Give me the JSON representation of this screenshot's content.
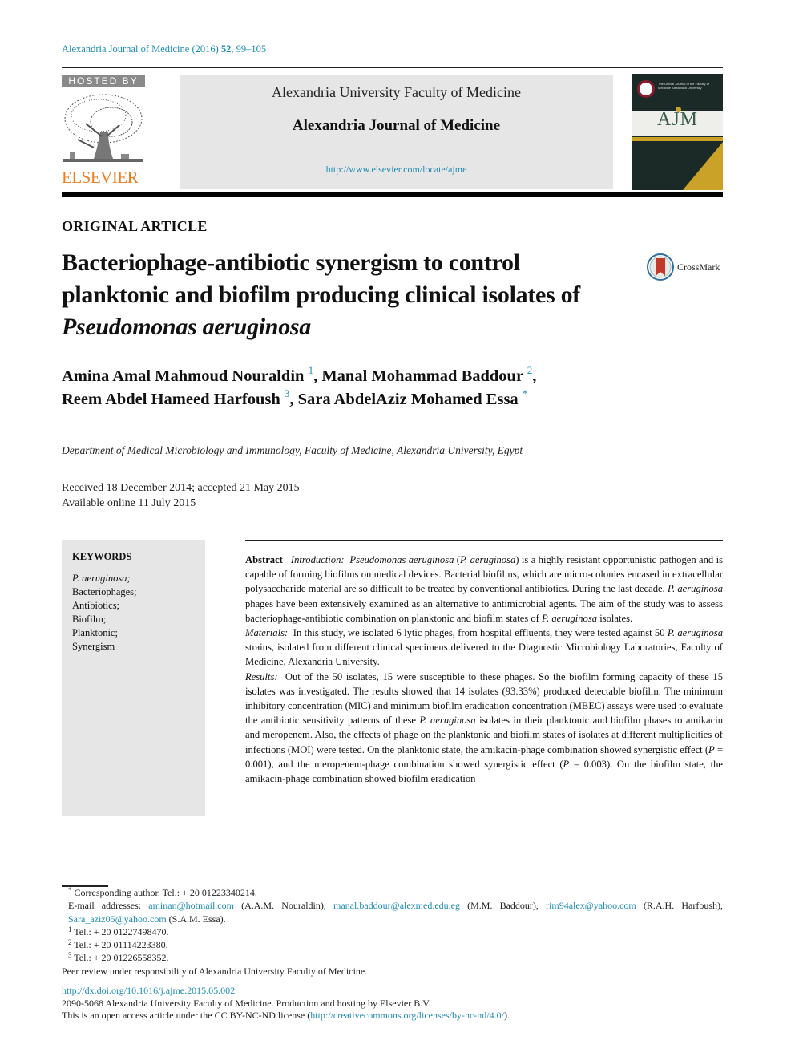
{
  "citation": {
    "journal": "Alexandria Journal of Medicine (2016)",
    "volume": "52",
    "pages": ", 99–105"
  },
  "header": {
    "hosted_by": "HOSTED BY",
    "publisher_logo": "ELSEVIER",
    "university": "Alexandria University Faculty of Medicine",
    "journal_name": "Alexandria Journal of Medicine",
    "journal_url": "http://www.elsevier.com/locate/ajme",
    "cover": {
      "abbrev": "AJM",
      "tagline": "The Official Journal of the Faculty of Medicine Alexandria University"
    }
  },
  "article": {
    "section": "ORIGINAL ARTICLE",
    "title_line1": "Bacteriophage-antibiotic synergism to control",
    "title_line2": "planktonic and biofilm producing clinical isolates of",
    "title_line3_italic": "Pseudomonas aeruginosa",
    "crossmark_label": "CrossMark",
    "authors": [
      {
        "name": "Amina Amal Mahmoud Nouraldin",
        "mark": "1",
        "sep": ", "
      },
      {
        "name": "Manal Mohammad Baddour",
        "mark": "2",
        "sep": ","
      },
      {
        "name": "Reem Abdel Hameed Harfoush",
        "mark": "3",
        "sep": ", "
      },
      {
        "name": "Sara AbdelAziz Mohamed Essa",
        "mark": "*",
        "sep": ""
      }
    ],
    "affiliation": "Department of Medical Microbiology and Immunology, Faculty of Medicine, Alexandria University, Egypt",
    "received": "Received 18 December 2014; accepted 21 May 2015",
    "available": "Available online 11 July 2015"
  },
  "keywords": {
    "heading": "KEYWORDS",
    "items": [
      "P. aeruginosa;",
      "Bacteriophages;",
      "Antibiotics;",
      "Biofilm;",
      "Planktonic;",
      "Synergism"
    ]
  },
  "abstract": {
    "label": "Abstract",
    "intro_label": "Introduction:",
    "intro_species": "Pseudomonas aeruginosa",
    "intro_abbr": "P. aeruginosa",
    "intro_text1": " is a highly resistant opportunistic pathogen and is capable of forming biofilms on medical devices. Bacterial biofilms, which are micro-colonies encased in extracellular polysaccharide material are so difficult to be treated by conventional antibiotics. During the last decade, ",
    "intro_text2": " phages have been extensively examined as an alternative to antimicrobial agents. The aim of the study was to assess bacteriophage-antibiotic combination on planktonic and biofilm states of ",
    "intro_text3": " isolates.",
    "materials_label": "Materials:",
    "materials_text1": "In this study, we isolated 6 lytic phages, from hospital effluents, they were tested against 50 ",
    "materials_text2": " strains, isolated from different clinical specimens delivered to the Diagnostic Microbiology Laboratories, Faculty of Medicine, Alexandria University.",
    "results_label": "Results:",
    "results_text1": "Out of the 50 isolates, 15 were susceptible to these phages. So the biofilm forming capacity of these 15 isolates was investigated. The results showed that 14 isolates (93.33%) produced detectable biofilm. The minimum inhibitory concentration (MIC) and minimum biofilm eradication concentration (MBEC) assays were used to evaluate the antibiotic sensitivity patterns of these ",
    "results_text2": " isolates in their planktonic and biofilm phases to amikacin and meropenem. Also, the effects of phage on the planktonic and biofilm states of isolates at different multiplicities of infections (MOI) were tested. On the planktonic state, the amikacin-phage combination showed synergistic effect (",
    "p_symbol": "P",
    "results_text3": " = 0.001), and the meropenem-phage combination showed synergistic effect (",
    "results_text4": " = 0.003). On the biofilm state, the amikacin-phage combination showed biofilm eradication"
  },
  "footnotes": {
    "corresponding_mark": "*",
    "corresponding": "Corresponding author. Tel.: + 20 01223340214.",
    "email_label": "E-mail addresses: ",
    "emails": [
      {
        "address": "aminan@hotmail.com",
        "owner": " (A.A.M. Nouraldin), "
      },
      {
        "address": "manal.baddour@alexmed.edu.eg",
        "owner": " (M.M. Baddour), "
      },
      {
        "address": "rim94alex@yahoo.com",
        "owner": " (R.A.H. Harfoush), "
      },
      {
        "address": "Sara_aziz05@yahoo.com",
        "owner": " (S.A.M. Essa)."
      }
    ],
    "phones": [
      {
        "mark": "1",
        "text": "Tel.: + 20 01227498470."
      },
      {
        "mark": "2",
        "text": "Tel.: + 20 01114223380."
      },
      {
        "mark": "3",
        "text": "Tel.: + 20 01226558352."
      }
    ]
  },
  "footer": {
    "peer_review": "Peer review under responsibility of Alexandria University Faculty of Medicine.",
    "doi": "http://dx.doi.org/10.1016/j.ajme.2015.05.002",
    "issn": "2090-5068 Alexandria University Faculty of Medicine. Production and hosting by Elsevier B.V.",
    "license_prefix": "This is an open access article under the CC BY-NC-ND license (",
    "license_url": "http://creativecommons.org/licenses/by-nc-nd/4.0/",
    "license_suffix": ")."
  }
}
